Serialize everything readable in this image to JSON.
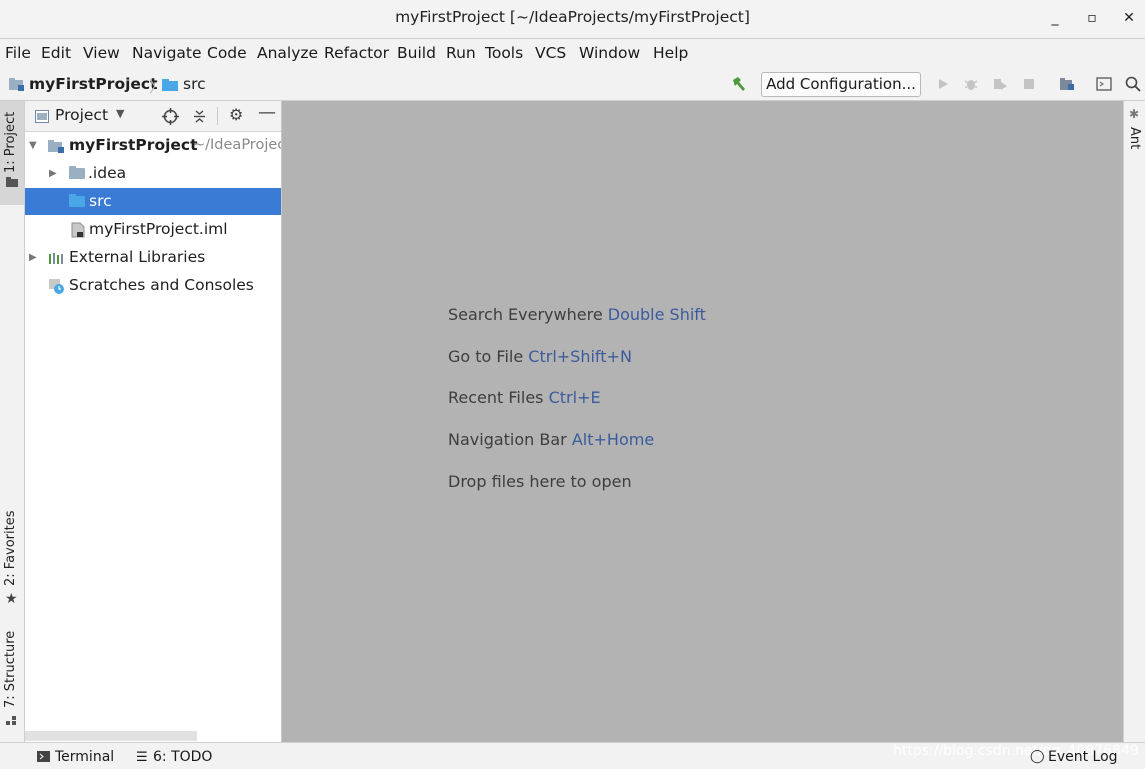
{
  "window": {
    "title": "myFirstProject [~/IdeaProjects/myFirstProject]",
    "minimize_glyph": "_",
    "maximize_glyph": "▫",
    "close_glyph": "✕"
  },
  "menu": [
    "File",
    "Edit",
    "View",
    "Navigate",
    "Code",
    "Analyze",
    "Refactor",
    "Build",
    "Run",
    "Tools",
    "VCS",
    "Window",
    "Help"
  ],
  "navbar": {
    "breadcrumbs": [
      "myFirstProject",
      "src"
    ],
    "add_configuration_label": "Add Configuration...",
    "icons": [
      "build-hammer-icon",
      "run-icon",
      "debug-icon",
      "coverage-icon",
      "stop-icon",
      "project-structure-icon",
      "terminal-window-icon",
      "search-icon"
    ]
  },
  "left_tool_tabs": [
    "1: Project",
    "2: Favorites",
    "7: Structure"
  ],
  "right_tool_tabs": [
    "Ant"
  ],
  "project_panel": {
    "view_selector_label": "Project",
    "tree": [
      {
        "label": "myFirstProject",
        "suffix": "~/IdeaProjec",
        "expanded": true,
        "icon": "module-folder-icon"
      },
      {
        "label": ".idea",
        "expanded": false,
        "icon": "folder-icon"
      },
      {
        "label": "src",
        "selected": true,
        "icon": "source-folder-icon"
      },
      {
        "label": "myFirstProject.iml",
        "icon": "iml-file-icon"
      },
      {
        "label": "External Libraries",
        "expanded": false,
        "icon": "libraries-icon"
      },
      {
        "label": "Scratches and Consoles",
        "icon": "scratches-icon"
      }
    ]
  },
  "editor": {
    "hints": [
      {
        "text": "Search Everywhere",
        "shortcut": "Double Shift"
      },
      {
        "text": "Go to File",
        "shortcut": "Ctrl+Shift+N"
      },
      {
        "text": "Recent Files",
        "shortcut": "Ctrl+E"
      },
      {
        "text": "Navigation Bar",
        "shortcut": "Alt+Home"
      },
      {
        "text": "Drop files here to open",
        "shortcut": ""
      }
    ]
  },
  "bottom_bar": {
    "terminal_label": "Terminal",
    "todo_label": "6: TODO",
    "event_log_label": "Event Log",
    "watermark": "https://blog.csdn.net/qq_40876849"
  },
  "colors": {
    "selection": "#3a7bd5",
    "editor_background": "#b3b3b3",
    "shortcut_text": "#3b5b9c",
    "folder": "#9ab0c2",
    "source_folder": "#49a7e5"
  }
}
